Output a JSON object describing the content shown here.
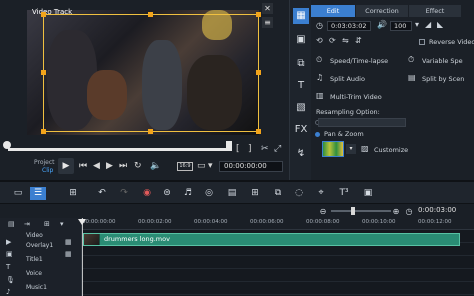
{
  "preview": {
    "track_label": "Video Track",
    "project_label": "Project",
    "clip_label": "Clip",
    "timecode": "00:00:00:00",
    "ratio_label": "16:9",
    "progress": 0.02
  },
  "options": {
    "tabs": [
      "Edit",
      "Correction",
      "Effect"
    ],
    "active_tab": "Edit",
    "duration": "0:03:03:02",
    "volume": "100",
    "reverse_video": "Reverse Video",
    "speed_time_lapse": "Speed/Time-lapse",
    "variable_speed": "Variable Spe",
    "split_audio": "Split Audio",
    "split_by_scene": "Split by Scen",
    "multi_trim": "Multi-Trim Video",
    "resampling": "Resampling Option:",
    "pan_zoom": "Pan & Zoom",
    "customize": "Customize"
  },
  "toolbar": {
    "icons": [
      "storyboard-icon",
      "timeline-view-icon",
      "undo-icon",
      "redo-icon",
      "record-icon",
      "sound-mixer-icon",
      "auto-music-icon",
      "subtitle-icon",
      "split-screen-icon",
      "motion-icon",
      "mask-icon",
      "3d-title-icon",
      "track-manager-icon"
    ]
  },
  "zoom": {
    "timecode": "0:00:03:00"
  },
  "ruler": {
    "ticks": [
      "00:00:00:00",
      "00:00:02:00",
      "00:00:04:00",
      "00:00:06:00",
      "00:00:08:00",
      "00:00:10:00",
      "00:00:12:00"
    ]
  },
  "tracks": {
    "labels": [
      "Video",
      "Overlay1",
      "Title1",
      "Voice",
      "Music1"
    ]
  },
  "clip": {
    "name": "drummers long.mov"
  },
  "colors": {
    "accent": "#3b7fd0",
    "clip": "#2a8c74",
    "crop_handle": "#f2a41b"
  }
}
